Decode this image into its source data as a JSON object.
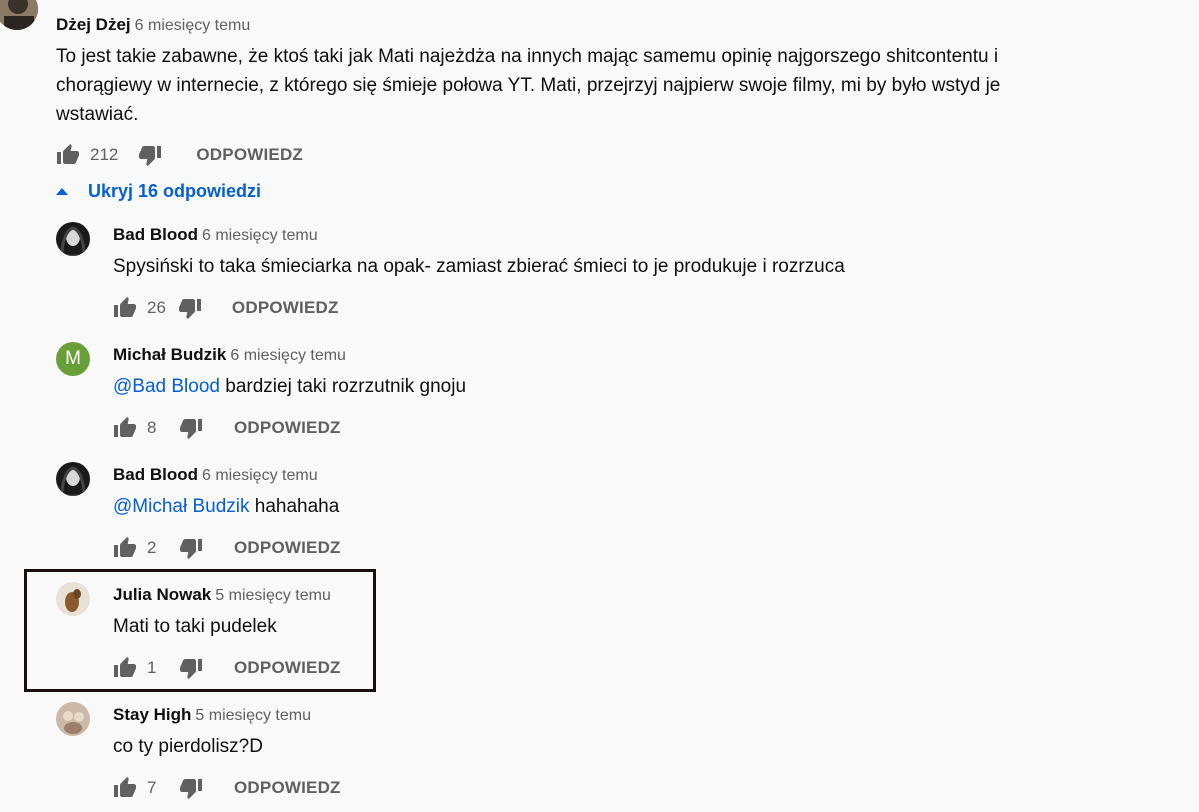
{
  "top_comment": {
    "author": "Dżej Dżej",
    "time": "6 miesięcy temu",
    "text": "To jest takie zabawne, że ktoś taki jak Mati najeżdża na innych mając samemu opinię najgorszego shitcontentu  i chorągiewy w internecie, z którego się śmieje połowa YT. Mati, przejrzyj najpierw swoje filmy, mi by było wstyd je wstawiać.",
    "likes": "212",
    "reply_label": "ODPOWIEDZ"
  },
  "toggle_replies": "Ukryj 16 odpowiedzi",
  "replies": [
    {
      "author": "Bad Blood",
      "time": "6 miesięcy temu",
      "mention": "",
      "text": "Spysiński to taka śmieciarka na opak- zamiast zbierać śmieci to je produkuje i rozrzuca",
      "likes": "26",
      "reply_label": "ODPOWIEDZ",
      "avatar": "photo-dark"
    },
    {
      "author": "Michał Budzik",
      "time": "6 miesięcy temu",
      "mention": "@Bad Blood",
      "text": " bardziej taki rozrzutnik gnoju",
      "likes": "8",
      "reply_label": "ODPOWIEDZ",
      "avatar": "letter",
      "avatar_letter": "M",
      "avatar_color": "#689f38"
    },
    {
      "author": "Bad Blood",
      "time": "6 miesięcy temu",
      "mention": "@Michał Budzik",
      "text": " hahahaha",
      "likes": "2",
      "reply_label": "ODPOWIEDZ",
      "avatar": "photo-dark"
    },
    {
      "author": "Julia Nowak",
      "time": "5 miesięcy temu",
      "mention": "",
      "text": "Mati to taki pudelek",
      "likes": "1",
      "reply_label": "ODPOWIEDZ",
      "avatar": "photo-dog"
    },
    {
      "author": "Stay High",
      "time": "5 miesięcy temu",
      "mention": "",
      "text": "co ty pierdolisz?D",
      "likes": "7",
      "reply_label": "ODPOWIEDZ",
      "avatar": "photo-light"
    }
  ],
  "colors": {
    "link": "#065fd4",
    "secondary": "#606060",
    "highlight_border": "#1a0e0e"
  }
}
